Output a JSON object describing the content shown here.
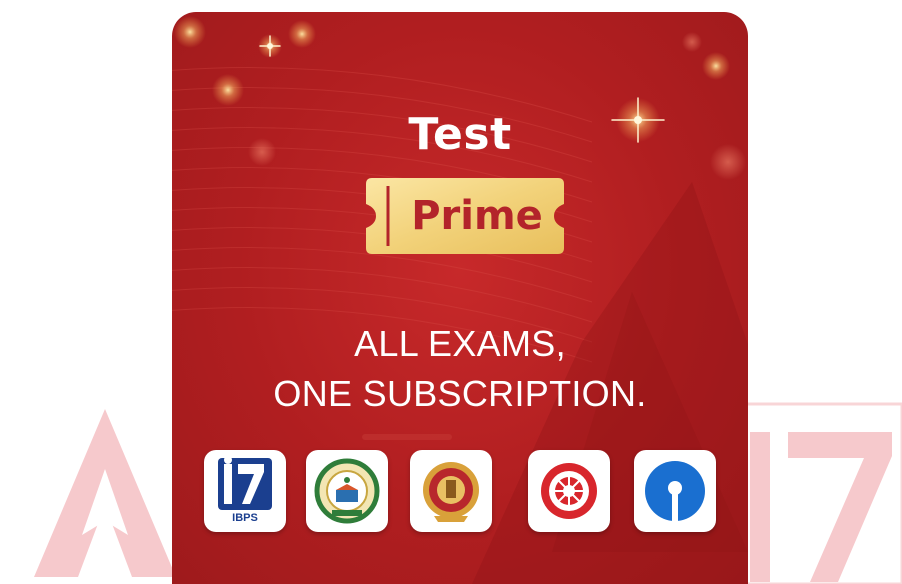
{
  "card": {
    "title": "Test",
    "badge": "Prime",
    "tagline_line1": "ALL EXAMS,",
    "tagline_line2": "ONE SUBSCRIPTION."
  },
  "logos": [
    {
      "icon": "ibps-logo-icon",
      "label": "IBPS"
    },
    {
      "icon": "ctet-logo-icon"
    },
    {
      "icon": "ssc-logo-icon"
    },
    {
      "icon": "railways-logo-icon"
    },
    {
      "icon": "sbi-logo-icon"
    }
  ],
  "watermark": {
    "text": "17"
  },
  "colors": {
    "card_red": "#b01e20",
    "ticket_gold": "#f2d27a",
    "prime_text": "#b3242a",
    "watermark_pink": "#f6c9cc",
    "sbi_blue": "#1a6fd0",
    "ibps_blue": "#1b3f8f"
  }
}
